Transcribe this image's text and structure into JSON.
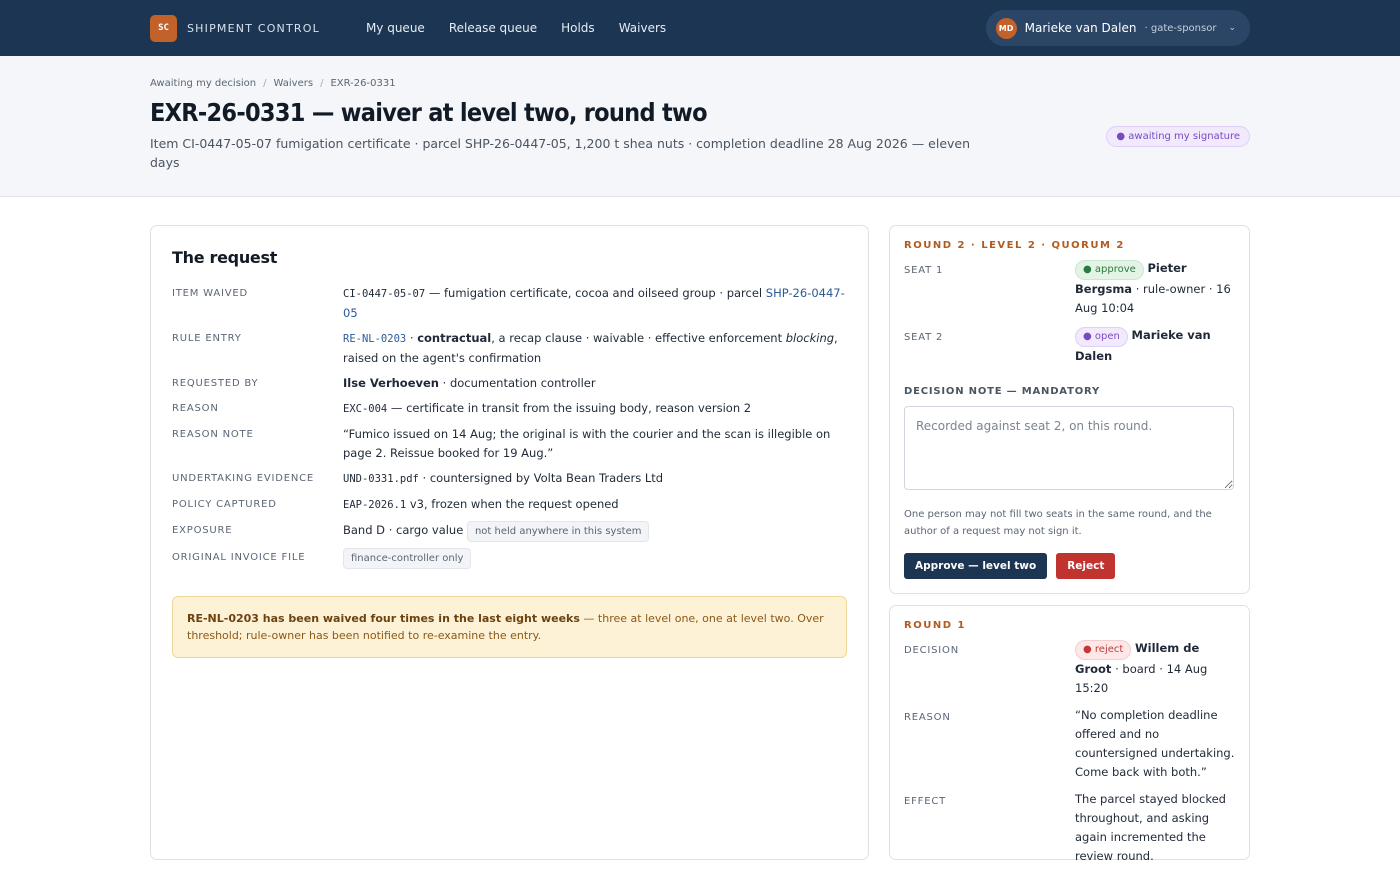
{
  "brand": {
    "mark": "SC",
    "name": "SHIPMENT CONTROL"
  },
  "nav": [
    "My queue",
    "Release queue",
    "Holds",
    "Waivers"
  ],
  "user": {
    "initials": "MD",
    "name": "Marieke van Dalen",
    "role": "· gate-sponsor"
  },
  "breadcrumb": [
    "Awaiting my decision",
    "Waivers",
    "EXR-26-0331"
  ],
  "page": {
    "title": "EXR-26-0331 — waiver at level two, round two",
    "subtitle": "Item CI-0447-05-07 fumigation certificate · parcel SHP-26-0447-05, 1,200 t shea nuts · completion deadline 28 Aug 2026 — eleven days",
    "status": "● awaiting my signature"
  },
  "request": {
    "title": "The request",
    "rows": {
      "item_waived": {
        "label": "ITEM WAIVED",
        "code": "CI-0447-05-07",
        "text": " — fumigation certificate, cocoa and oilseed group · parcel ",
        "link": "SHP-26-0447-05"
      },
      "rule_entry": {
        "label": "RULE ENTRY",
        "code": "RE-NL-0203",
        "sep": " · ",
        "strong": "contractual",
        "text1": ", a recap clause · waivable · effective enforcement ",
        "em": "blocking",
        "text2": ", raised on the agent's confirmation"
      },
      "requested_by": {
        "label": "REQUESTED BY",
        "strong": "Ilse Verhoeven",
        "text": " · documentation controller"
      },
      "reason": {
        "label": "REASON",
        "code": "EXC-004",
        "text": " — certificate in transit from the issuing body, reason version 2"
      },
      "reason_note": {
        "label": "REASON NOTE",
        "text": "“Fumico issued on 14 Aug; the original is with the courier and the scan is illegible on page 2. Reissue booked for 19 Aug.”"
      },
      "undertaking": {
        "label": "UNDERTAKING EVIDENCE",
        "code": "UND-0331.pdf",
        "text": " · countersigned by Volta Bean Traders Ltd"
      },
      "policy": {
        "label": "POLICY CAPTURED",
        "code": "EAP-2026.1",
        "text": " v3, frozen when the request opened"
      },
      "exposure": {
        "label": "EXPOSURE",
        "text": "Band D · cargo value ",
        "tag": "not held anywhere in this system"
      },
      "invoice": {
        "label": "ORIGINAL INVOICE FILE",
        "tag": "finance-controller only"
      }
    },
    "warning": {
      "strong": "RE-NL-0203 has been waived four times in the last eight weeks",
      "text": " — three at level one, one at level two. Over threshold; rule-owner has been notified to re-examine the entry."
    }
  },
  "round2": {
    "heading": "ROUND 2 · LEVEL 2 · QUORUM 2",
    "seat1": {
      "label": "SEAT 1",
      "chip": "● approve",
      "name": "Pieter Bergsma",
      "detail": " · rule-owner · 16 Aug 10:04"
    },
    "seat2": {
      "label": "SEAT 2",
      "chip": "● open",
      "name": "Marieke van Dalen"
    },
    "note_label": "DECISION NOTE — MANDATORY",
    "note_placeholder": "Recorded against seat 2, on this round.",
    "help": "One person may not fill two seats in the same round, and the author of a request may not sign it.",
    "approve": "Approve — level two",
    "reject": "Reject"
  },
  "round1": {
    "heading": "ROUND 1",
    "decision": {
      "label": "DECISION",
      "chip": "● reject",
      "name": "Willem de Groot",
      "detail": " · board · 14 Aug 15:20"
    },
    "reason": {
      "label": "REASON",
      "text": "“No completion deadline offered and no countersigned undertaking. Come back with both.”"
    },
    "effect": {
      "label": "EFFECT",
      "text": "The parcel stayed blocked throughout, and asking again incremented the review round."
    }
  }
}
